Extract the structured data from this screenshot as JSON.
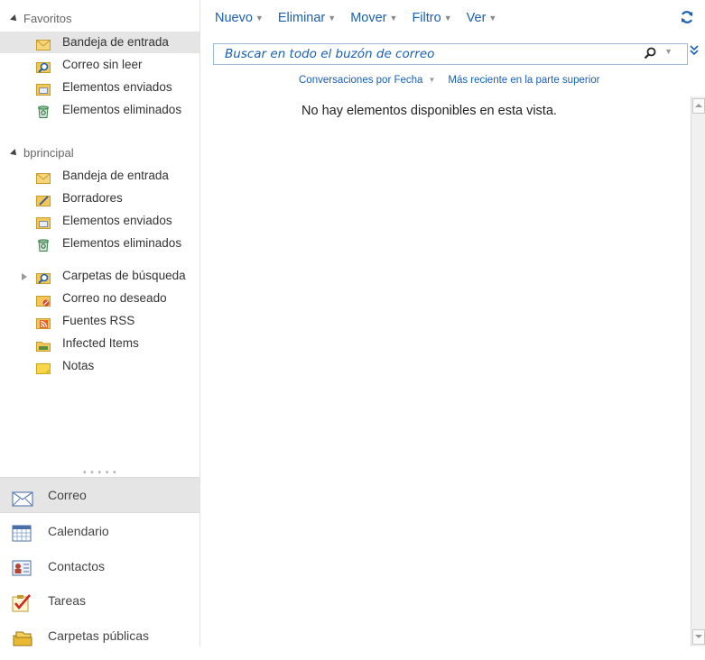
{
  "favorites": {
    "header": "Favoritos",
    "items": [
      {
        "label": "Bandeja de entrada",
        "icon": "inbox-icon",
        "selected": true
      },
      {
        "label": "Correo sin leer",
        "icon": "search-folder-icon"
      },
      {
        "label": "Elementos enviados",
        "icon": "sent-icon"
      },
      {
        "label": "Elementos eliminados",
        "icon": "trash-icon"
      }
    ]
  },
  "account": {
    "header": "bprincipal",
    "items": [
      {
        "label": "Bandeja de entrada",
        "icon": "inbox-icon"
      },
      {
        "label": "Borradores",
        "icon": "drafts-icon"
      },
      {
        "label": "Elementos enviados",
        "icon": "sent-icon"
      },
      {
        "label": "Elementos eliminados",
        "icon": "trash-icon"
      },
      {
        "label": "Carpetas de búsqueda",
        "icon": "search-folder-icon",
        "expandable": true
      },
      {
        "label": "Correo no deseado",
        "icon": "junk-icon"
      },
      {
        "label": "Fuentes RSS",
        "icon": "rss-icon"
      },
      {
        "label": "Infected Items",
        "icon": "folder-icon"
      },
      {
        "label": "Notas",
        "icon": "notes-icon"
      }
    ]
  },
  "modules": [
    {
      "label": "Correo",
      "icon": "mail-icon",
      "selected": true
    },
    {
      "label": "Calendario",
      "icon": "calendar-icon"
    },
    {
      "label": "Contactos",
      "icon": "contacts-icon"
    },
    {
      "label": "Tareas",
      "icon": "tasks-icon"
    },
    {
      "label": "Carpetas públicas",
      "icon": "public-folders-icon"
    }
  ],
  "toolbar": {
    "new": "Nuevo",
    "delete": "Eliminar",
    "move": "Mover",
    "filter": "Filtro",
    "view": "Ver"
  },
  "search": {
    "placeholder": "Buscar en todo el buzón de correo"
  },
  "sort": {
    "by": "Conversaciones por Fecha",
    "order": "Más reciente en la parte superior"
  },
  "empty_message": "No hay elementos disponibles en esta vista.",
  "colors": {
    "accent": "#1a5fb4",
    "selected_bg": "#e5e5e5"
  }
}
